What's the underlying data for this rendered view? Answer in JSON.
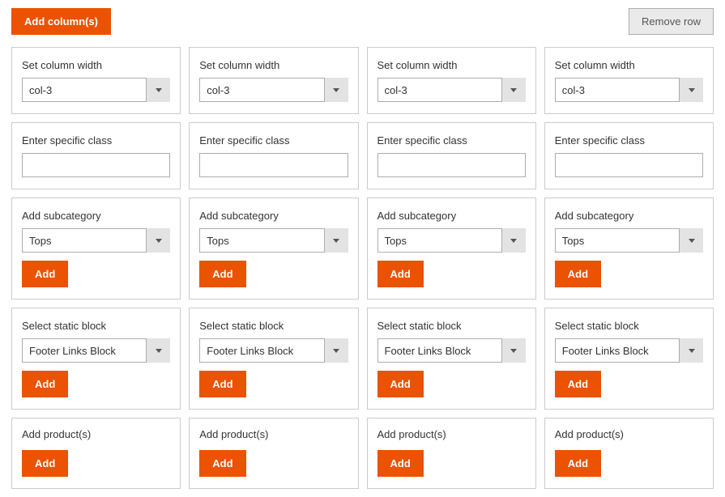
{
  "buttons": {
    "add_columns": "Add column(s)",
    "remove_row": "Remove row",
    "add": "Add"
  },
  "labels": {
    "set_column_width": "Set column width",
    "enter_specific_class": "Enter specific class",
    "add_subcategory": "Add subcategory",
    "select_static_block": "Select static block",
    "add_products": "Add product(s)"
  },
  "columns": [
    {
      "width_value": "col-3",
      "specific_class": "",
      "subcategory_value": "Tops",
      "static_block_value": "Footer Links Block"
    },
    {
      "width_value": "col-3",
      "specific_class": "",
      "subcategory_value": "Tops",
      "static_block_value": "Footer Links Block"
    },
    {
      "width_value": "col-3",
      "specific_class": "",
      "subcategory_value": "Tops",
      "static_block_value": "Footer Links Block"
    },
    {
      "width_value": "col-3",
      "specific_class": "",
      "subcategory_value": "Tops",
      "static_block_value": "Footer Links Block"
    }
  ]
}
